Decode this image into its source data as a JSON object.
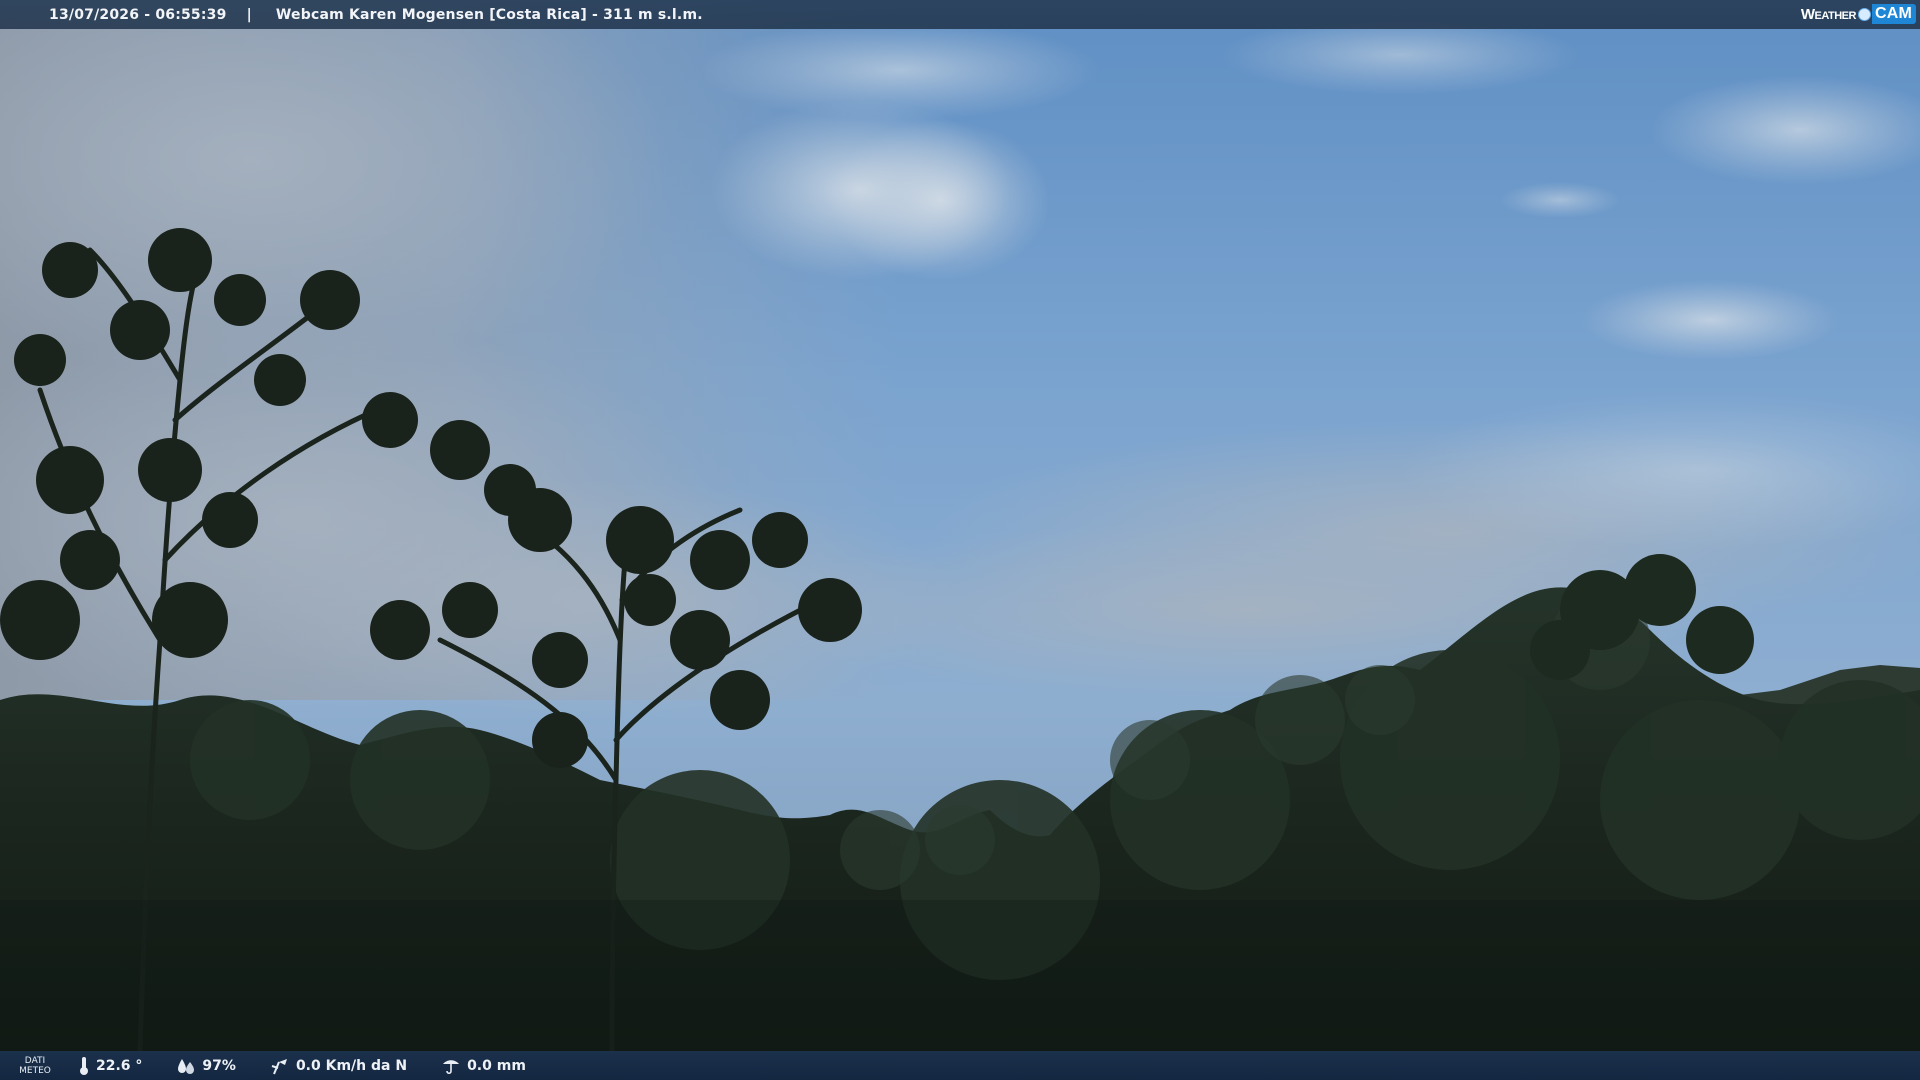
{
  "overlay": {
    "datetime": "13/07/2026 - 06:55:39",
    "separator": "|",
    "title": "Webcam Karen Mogensen [Costa Rica]  - 311 m s.l.m.",
    "brand_weather": "Weather",
    "brand_cam": "CAM",
    "brand_color": "#1f86d6"
  },
  "weather": {
    "label_line1": "DATI",
    "label_line2": "METEO",
    "temperature": "22.6 °",
    "humidity": "97%",
    "wind": "0.0 Km/h da N",
    "rain": "0.0 mm",
    "icons": [
      "thermometer-icon",
      "humidity-icon",
      "wind-icon",
      "rain-icon"
    ]
  },
  "scene": {
    "description_colors": {
      "sky_top": "#6f97c6",
      "sky_mid": "#7ea3cc",
      "cloud": "#b9c7d6",
      "forest_dark": "#141d16",
      "forest_mid": "#1f2e22"
    }
  }
}
